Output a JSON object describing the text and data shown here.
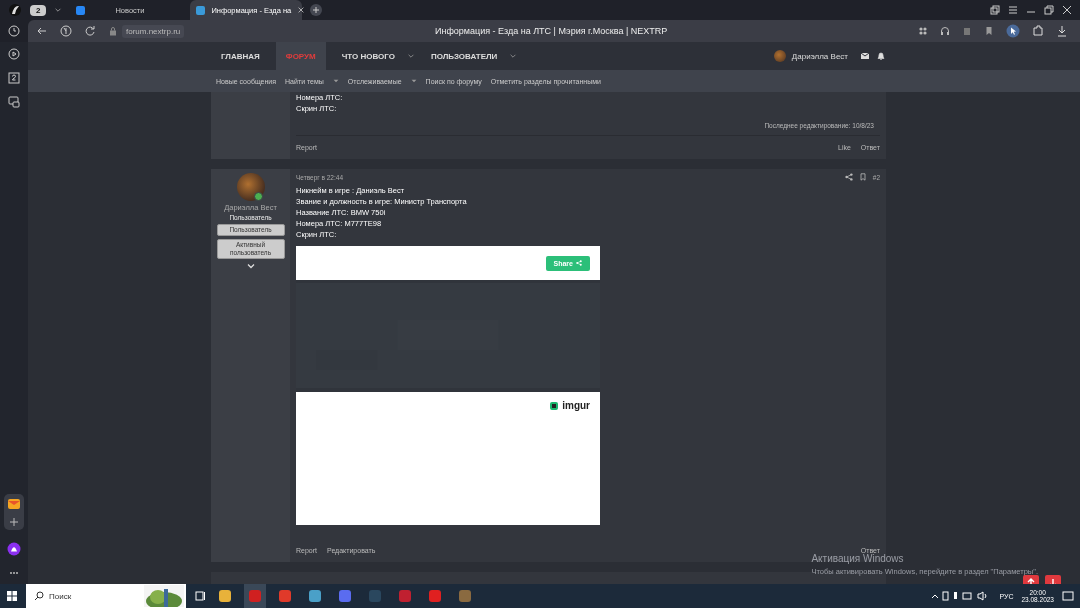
{
  "browser": {
    "tab_count": "2",
    "tabs": [
      {
        "label": "Новости",
        "selected": false
      },
      {
        "label": "Информация - Езда на",
        "selected": true
      }
    ],
    "url": "forum.nextrp.ru",
    "page_title": "Информация - Езда на ЛТС | Мэрия г.Москва | NEXTRP"
  },
  "nav": {
    "items": [
      {
        "label": "ГЛАВНАЯ",
        "selected": false,
        "dropdown": false
      },
      {
        "label": "ФОРУМ",
        "selected": true,
        "dropdown": false
      },
      {
        "label": "ЧТО НОВОГО",
        "selected": false,
        "dropdown": true
      },
      {
        "label": "ПОЛЬЗОВАТЕЛИ",
        "selected": false,
        "dropdown": true
      }
    ],
    "user": "Дариэлла Вест"
  },
  "subnav": [
    {
      "label": "Новые сообщения",
      "dropdown": false
    },
    {
      "label": "Найти темы",
      "dropdown": true
    },
    {
      "label": "Отслеживаемые",
      "dropdown": true
    },
    {
      "label": "Поиск по форуму",
      "dropdown": false
    },
    {
      "label": "Отметить разделы прочитанными",
      "dropdown": false
    }
  ],
  "posts": [
    {
      "lines": [
        "Номера ЛТС:",
        "Скрин ЛТС:"
      ],
      "edited": "Последнее редактирование: 10/8/23",
      "actions": [
        "Report"
      ],
      "right_actions": [
        "Like",
        "Ответ"
      ]
    },
    {
      "date": "Четверг в 22:44",
      "number": "#2",
      "author": "Дариэлла Вест",
      "role": "Пользователь",
      "badges": [
        "Пользователь",
        "Активный пользователь"
      ],
      "lines": [
        "Никнейм в игре : Даниэль Вест",
        "Звание и должность в игре: Министр Транспорта",
        "Название ЛТС: BMW 750i",
        "Номера ЛТС: M777TE98",
        "Скрин ЛТС:"
      ],
      "embed": {
        "share": "Share",
        "brand": "imgur"
      },
      "actions": [
        "Report",
        "Редактировать"
      ],
      "right_actions": [
        "Ответ"
      ]
    }
  ],
  "activation": {
    "title": "Активация Windows",
    "text": "Чтобы активировать Windows, перейдите в раздел \"Параметры\"."
  },
  "taskbar": {
    "search": "Поиск",
    "lang": "РУС",
    "time": "20:00",
    "date": "23.08.2023"
  }
}
